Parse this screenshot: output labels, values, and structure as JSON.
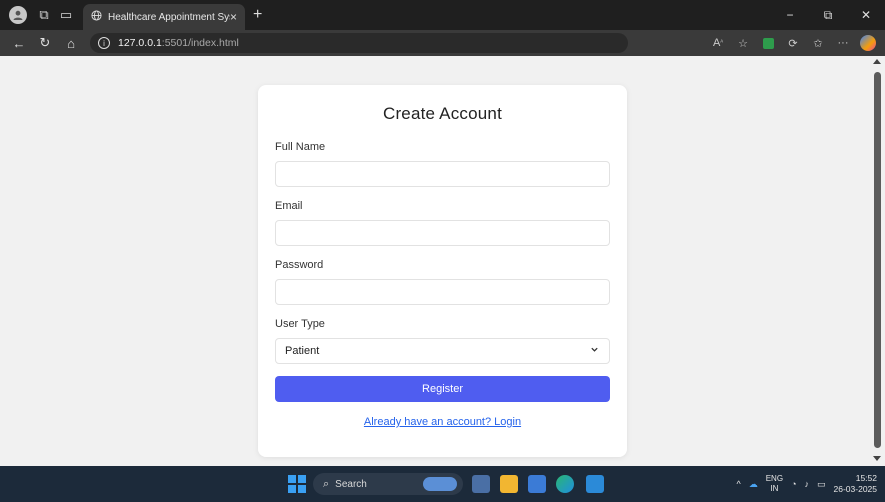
{
  "browser": {
    "tab_title": "Healthcare Appointment System",
    "tab_close": "×",
    "new_tab": "+",
    "url_host": "127.0.0.1",
    "url_path": ":5501/index.html",
    "window_controls": [
      "−",
      "⧉",
      "✕"
    ]
  },
  "form": {
    "title": "Create Account",
    "full_name_label": "Full Name",
    "full_name_value": "",
    "email_label": "Email",
    "email_value": "",
    "password_label": "Password",
    "password_value": "",
    "user_type_label": "User Type",
    "user_type_selected": "Patient",
    "register_label": "Register",
    "login_link": "Already have an account? Login"
  },
  "taskbar": {
    "search_placeholder": "Search",
    "lang_top": "ENG",
    "lang_bottom": "IN",
    "time": "15:52",
    "date": "26-03-2025"
  },
  "colors": {
    "accent": "#4f5df0",
    "link": "#2563eb",
    "page_bg": "#f1f1f1"
  },
  "icons": [
    "profile-icon",
    "workspaces-icon",
    "tab-actions-icon",
    "globe-icon",
    "back-icon",
    "refresh-icon",
    "home-icon",
    "info-icon",
    "read-aloud-icon",
    "favorite-icon",
    "extension-icon",
    "split-screen-icon",
    "favorites-bar-icon",
    "more-icon",
    "copilot-icon",
    "chevron-down-icon",
    "windows-start-icon",
    "search-icon"
  ]
}
